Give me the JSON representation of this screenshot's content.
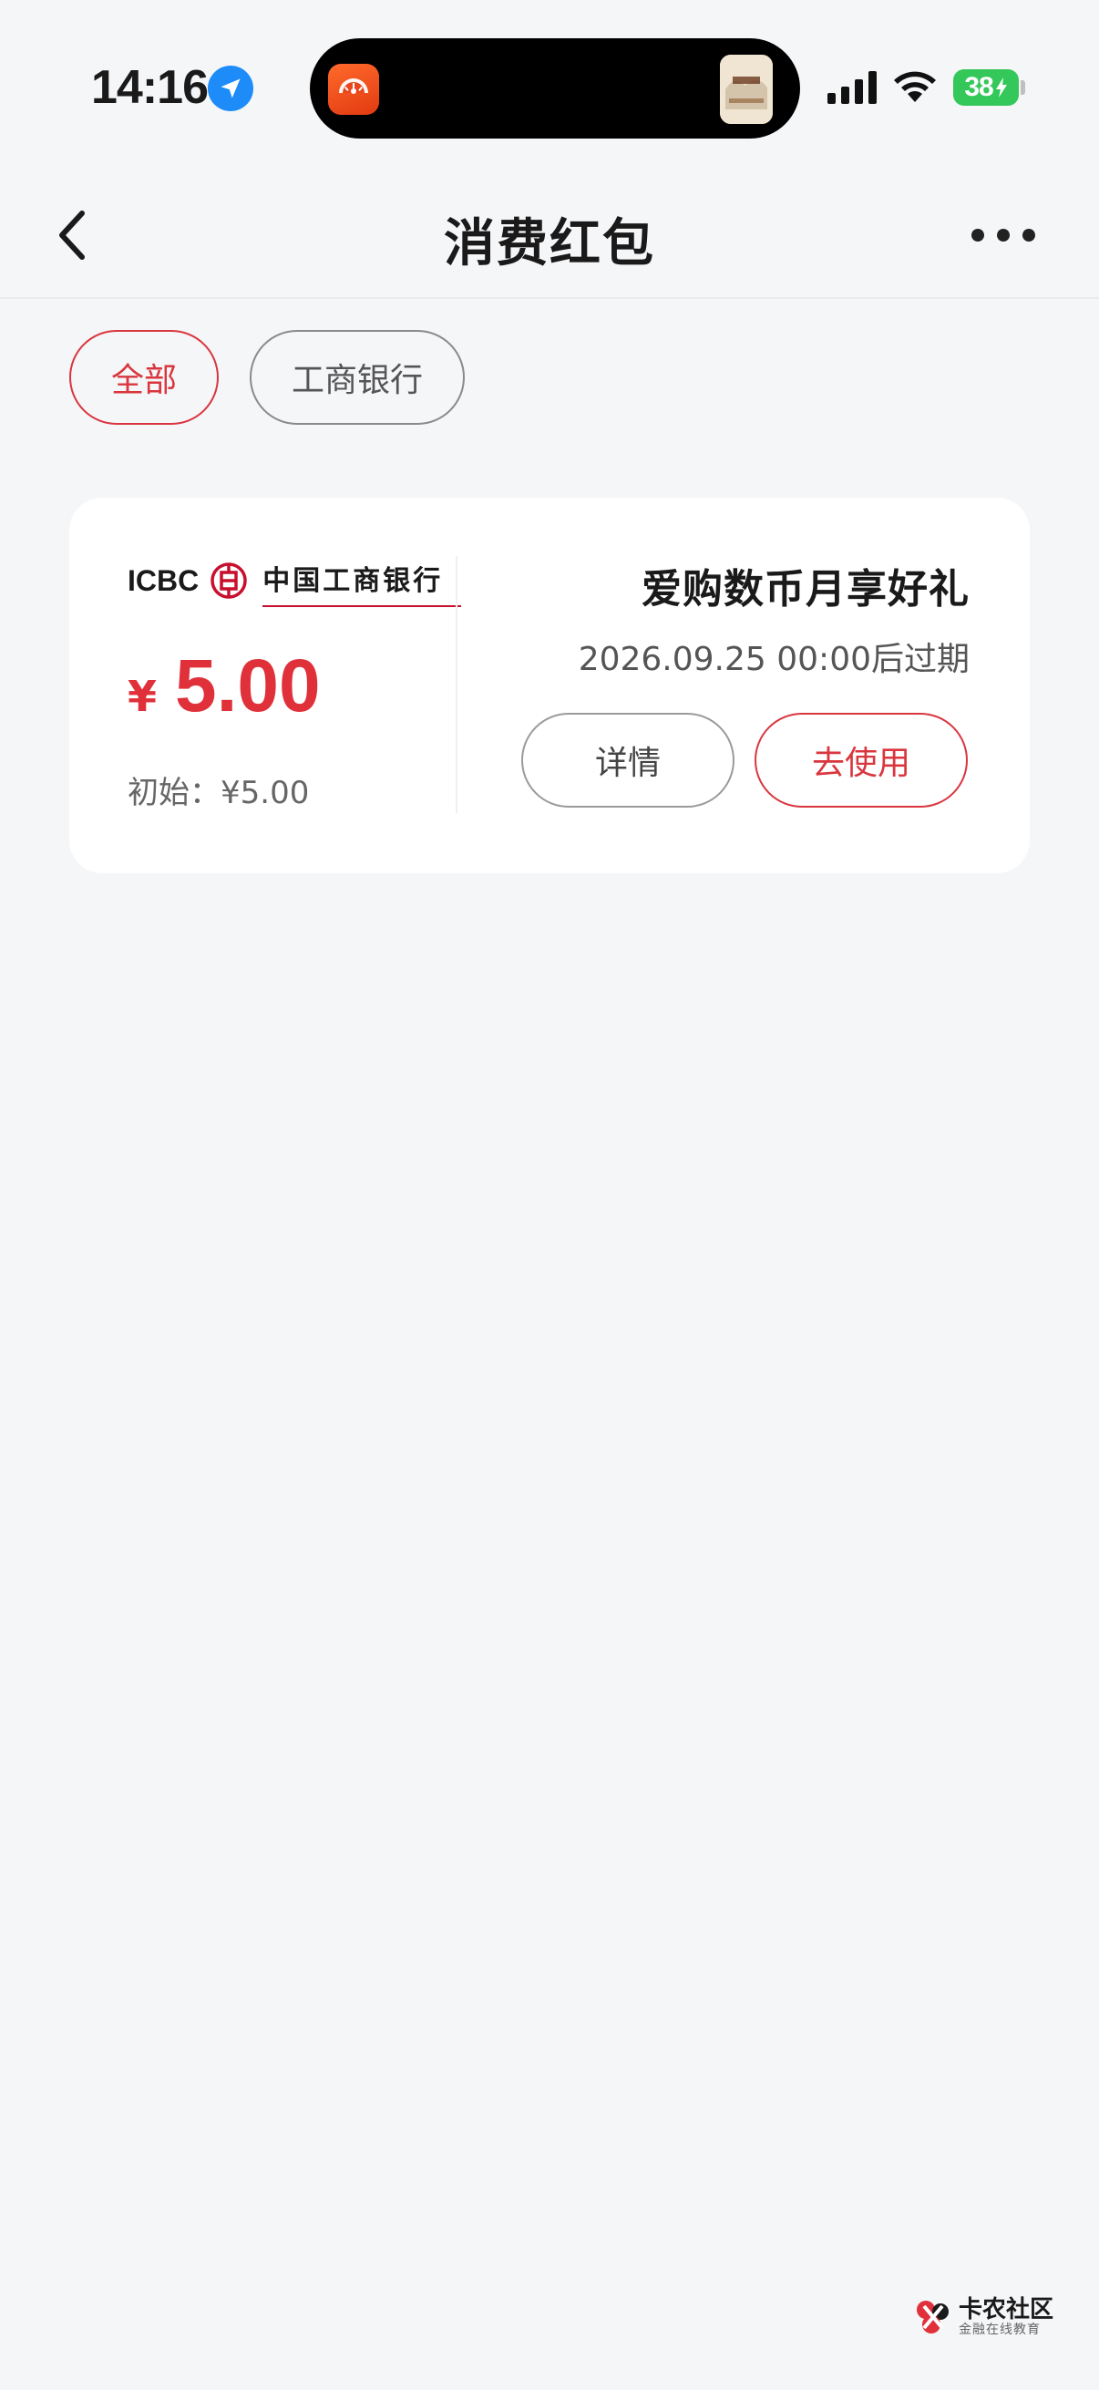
{
  "status_bar": {
    "time": "14:16",
    "battery": "38",
    "icons": [
      "location-icon",
      "signal-icon",
      "wifi-icon",
      "battery-icon"
    ]
  },
  "nav": {
    "title": "消费红包",
    "icons": [
      "back-icon",
      "more-icon"
    ]
  },
  "filters": [
    {
      "label": "全部",
      "active": true
    },
    {
      "label": "工商银行",
      "active": false
    }
  ],
  "coupon": {
    "bank_en": "ICBC",
    "bank_cn": "中国工商银行",
    "currency": "¥",
    "amount": "5.00",
    "initial": "初始：¥5.00",
    "title": "爱购数币月享好礼",
    "expiry": "2026.09.25 00:00后过期",
    "detail_label": "详情",
    "use_label": "去使用"
  },
  "watermark": {
    "name": "卡农社区",
    "subtitle": "金融在线教育"
  },
  "colors": {
    "accent": "#d9363e",
    "amount": "#e0303a",
    "background": "#f5f6f8",
    "card": "#ffffff",
    "battery": "#34c759",
    "location": "#1d8cf8"
  }
}
